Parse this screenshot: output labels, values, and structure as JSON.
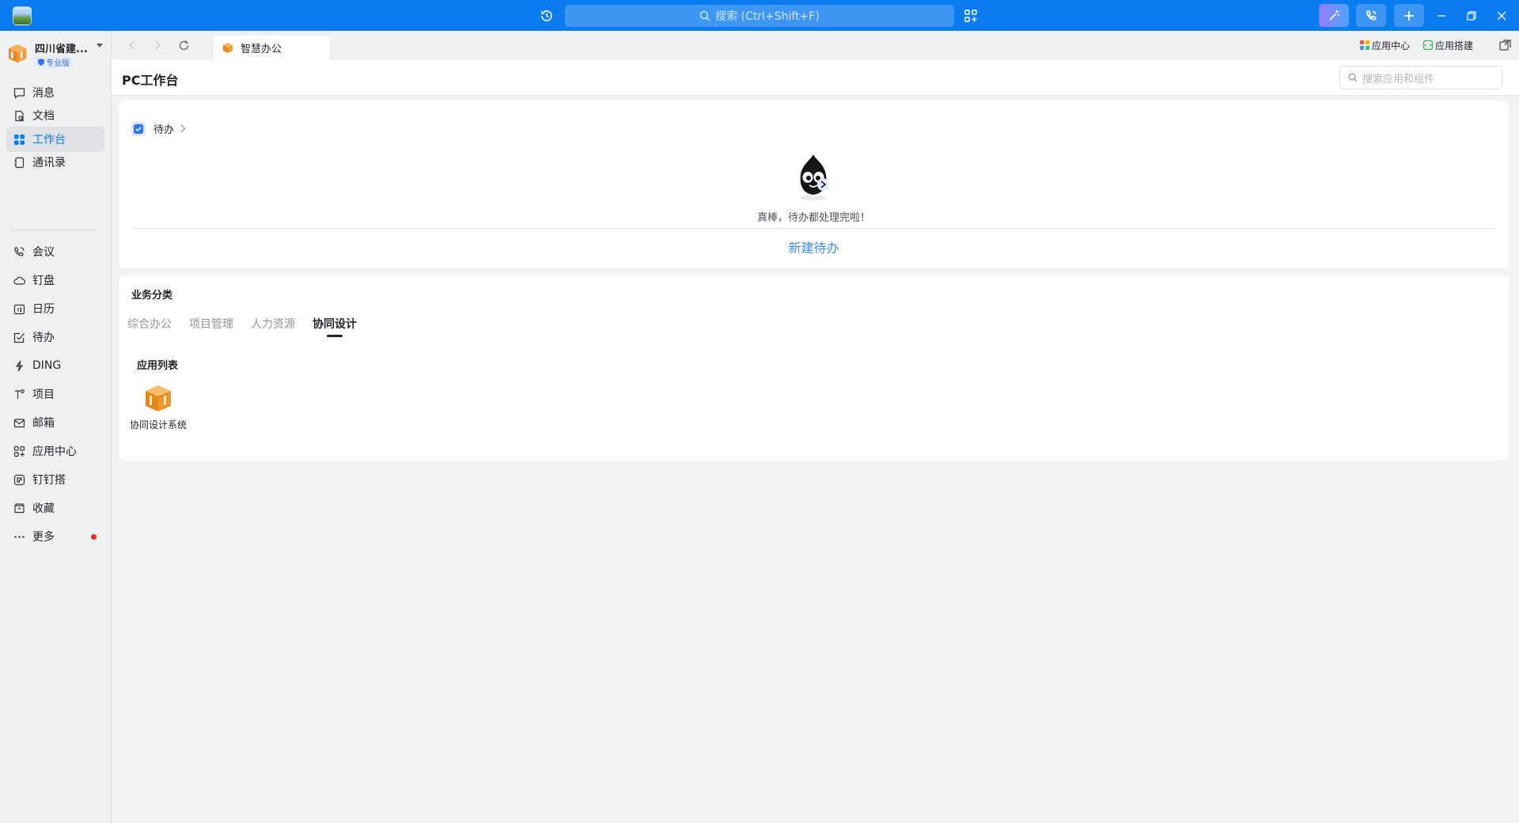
{
  "titlebar": {
    "search_placeholder": "搜索 (Ctrl+Shift+F)"
  },
  "sidebar": {
    "org_name": "四川省建...",
    "org_badge": "专业版",
    "items": [
      {
        "label": "消息",
        "icon": "message-icon"
      },
      {
        "label": "文档",
        "icon": "document-icon"
      },
      {
        "label": "工作台",
        "icon": "workbench-icon",
        "active": true
      },
      {
        "label": "通讯录",
        "icon": "contacts-icon"
      },
      {
        "label": "会议",
        "icon": "meeting-icon"
      },
      {
        "label": "钉盘",
        "icon": "cloud-drive-icon"
      },
      {
        "label": "日历",
        "icon": "calendar-icon"
      },
      {
        "label": "待办",
        "icon": "todo-icon"
      },
      {
        "label": "DING",
        "icon": "ding-icon"
      },
      {
        "label": "项目",
        "icon": "project-icon"
      },
      {
        "label": "邮箱",
        "icon": "mail-icon"
      },
      {
        "label": "应用中心",
        "icon": "app-center-icon"
      },
      {
        "label": "钉钉搭",
        "icon": "dingda-icon"
      },
      {
        "label": "收藏",
        "icon": "favorites-icon"
      },
      {
        "label": "更多",
        "icon": "more-icon",
        "has_notification_dot": true
      }
    ]
  },
  "tabbar": {
    "tab_label": "智慧办公",
    "app_center_link": "应用中心",
    "app_builder_link": "应用搭建"
  },
  "page": {
    "title": "PC工作台",
    "search_placeholder": "搜索应用和组件"
  },
  "todo": {
    "title": "待办",
    "empty_message": "真棒，待办都处理完啦！",
    "new_todo_label": "新建待办"
  },
  "business": {
    "title": "业务分类",
    "tabs": [
      "综合办公",
      "项目管理",
      "人力资源",
      "协同设计"
    ],
    "active_tab": "协同设计",
    "app_list_title": "应用列表",
    "apps": [
      {
        "name": "协同设计系统",
        "icon": "box-app-icon"
      }
    ]
  },
  "colors": {
    "titlebar_bg": "#0b7bf0",
    "accent": "#0b7bf0",
    "link": "#3b8ff5",
    "notification": "#f52929"
  }
}
